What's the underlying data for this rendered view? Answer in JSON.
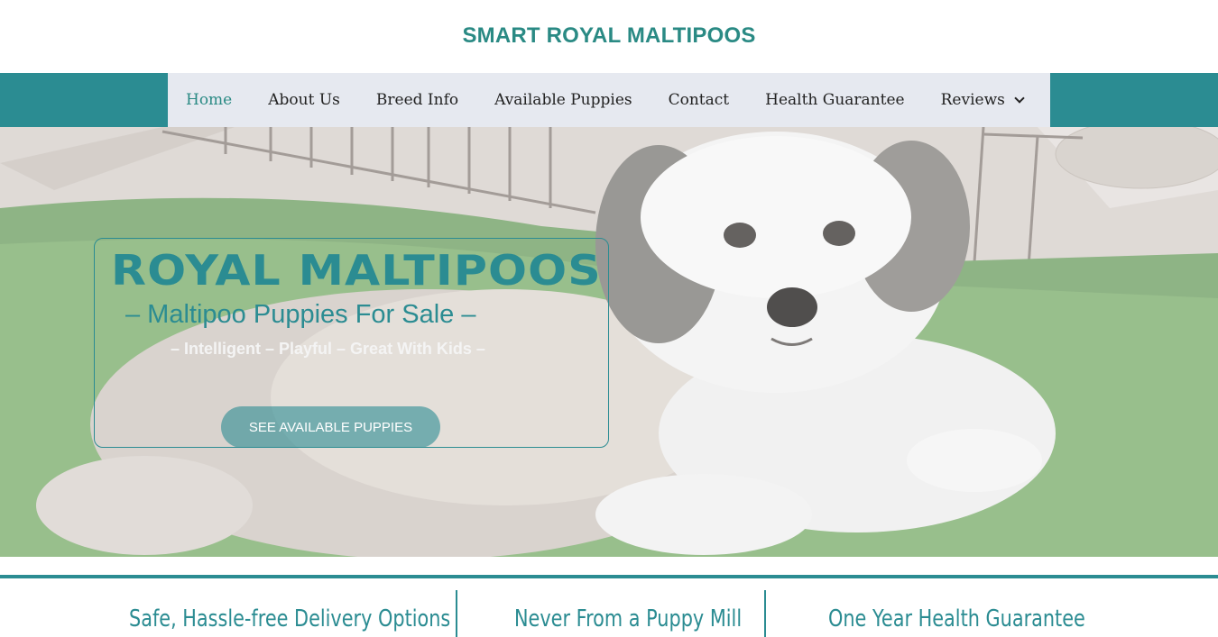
{
  "site": {
    "title": "SMART ROYAL MALTIPOOS"
  },
  "nav": {
    "items": [
      {
        "label": "Home"
      },
      {
        "label": "About Us"
      },
      {
        "label": "Breed Info"
      },
      {
        "label": "Available Puppies"
      },
      {
        "label": "Contact"
      },
      {
        "label": "Health Guarantee"
      },
      {
        "label": "Reviews"
      }
    ]
  },
  "hero": {
    "title": "ROYAL MALTIPOOS",
    "subtitle": "– Maltipoo Puppies For Sale –",
    "tagline": "– Intelligent – Playful – Great With Kids –",
    "button": "SEE AVAILABLE PUPPIES"
  },
  "features": [
    {
      "label": "Safe, Hassle-free Delivery Options"
    },
    {
      "label": "Never From a Puppy Mill"
    },
    {
      "label": "One Year Health Guarantee"
    }
  ],
  "colors": {
    "accent": "#2b8c92",
    "nav_bg": "#e6e9f0",
    "title": "#2a8a84"
  }
}
